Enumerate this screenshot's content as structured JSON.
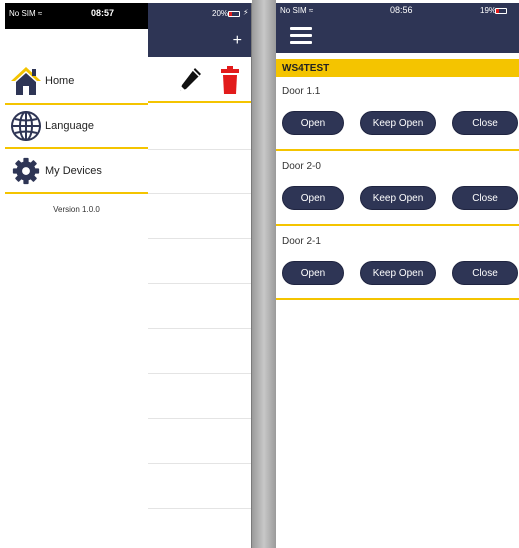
{
  "left_phone": {
    "status": {
      "carrier": "No SIM ≈",
      "time": "08:57",
      "battery": "20%"
    },
    "header": {
      "add_label": "+"
    },
    "menu": {
      "items": [
        {
          "label": "Home",
          "icon": "home-icon"
        },
        {
          "label": "Language",
          "icon": "globe-icon"
        },
        {
          "label": "My Devices",
          "icon": "gear-icon"
        }
      ],
      "version": "Version 1.0.0"
    },
    "colors": {
      "navy": "#2e3555",
      "accent": "#f4c400",
      "delete": "#e21b1b"
    }
  },
  "right_phone": {
    "status": {
      "carrier": "No SIM ≈",
      "time": "08:56",
      "battery": "19%"
    },
    "site": "WS4TEST",
    "doors": [
      {
        "name": "Door 1.1",
        "open": "Open",
        "keep_open": "Keep Open",
        "close": "Close"
      },
      {
        "name": "Door 2-0",
        "open": "Open",
        "keep_open": "Keep Open",
        "close": "Close"
      },
      {
        "name": "Door 2-1",
        "open": "Open",
        "keep_open": "Keep Open",
        "close": "Close"
      }
    ]
  }
}
